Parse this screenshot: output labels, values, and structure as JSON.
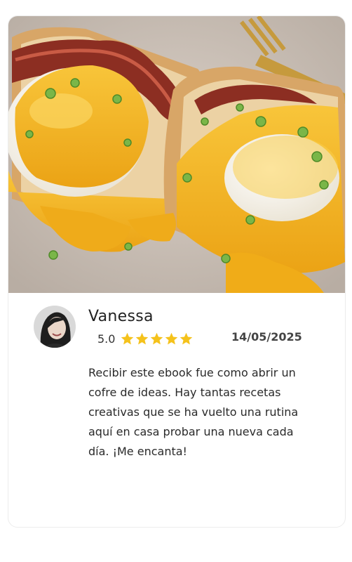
{
  "review": {
    "reviewer_name": "Vanessa",
    "rating_value": "5.0",
    "stars": 5,
    "date": "14/05/2025",
    "text": "Recibir este ebook fue como abrir un cofre de ideas. Hay tantas recetas creativas que se ha vuelto una rutina aquí en casa probar una nueva cada día. ¡Me encanta!"
  },
  "colors": {
    "star": "#f5c21b",
    "yolk": "#f2b41a",
    "plate": "#cfc5bb"
  },
  "icons": {
    "star": "star-icon"
  }
}
